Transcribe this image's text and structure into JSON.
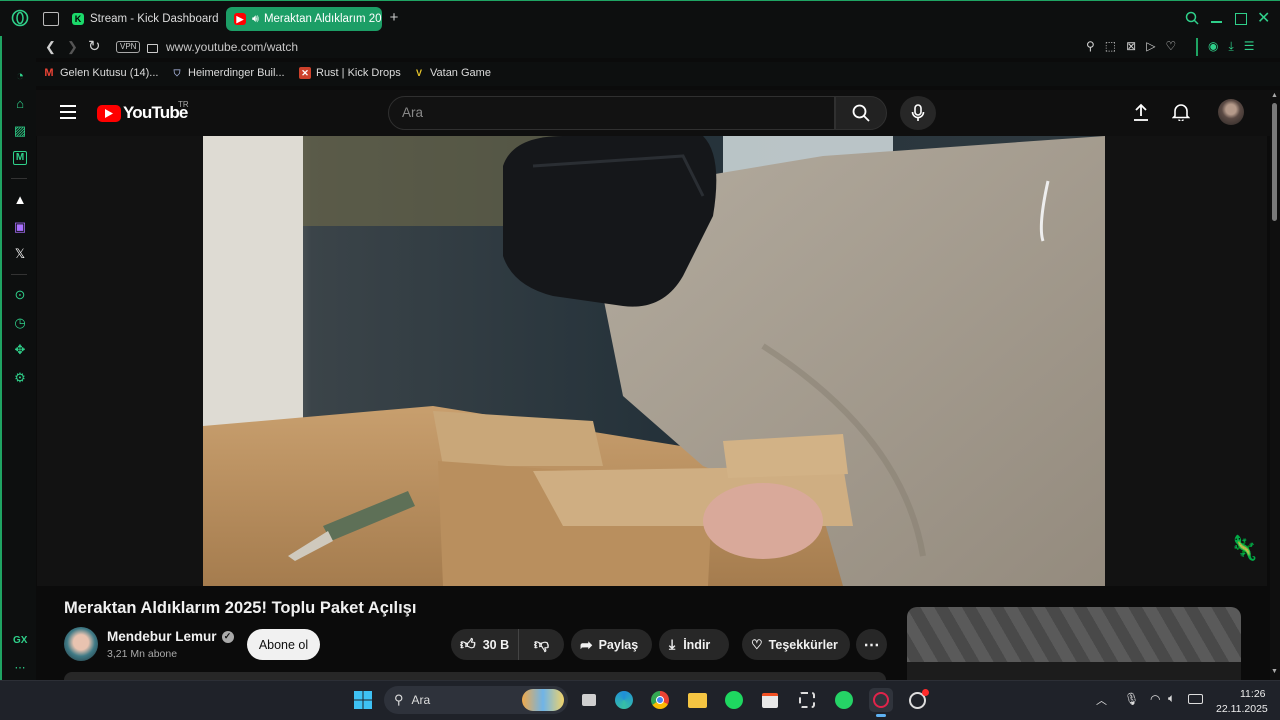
{
  "browser": {
    "tabs": [
      {
        "label": "Stream - Kick Dashboard",
        "active": false
      },
      {
        "label": "Meraktan Aldıklarım 20",
        "active": true
      }
    ],
    "vpn_label": "VPN",
    "url": "www.youtube.com/watch",
    "bookmarks": [
      {
        "label": "Gelen Kutusu (14)..."
      },
      {
        "label": "Heimerdinger Buil..."
      },
      {
        "label": "Rust | Kick Drops"
      },
      {
        "label": "Vatan Game"
      }
    ],
    "sidebar_gx": "GX",
    "accent": "#1fa463"
  },
  "youtube": {
    "logo_text": "YouTube",
    "region": "TR",
    "search_placeholder": "Ara",
    "video_title": "Meraktan Aldıklarım 2025! Toplu Paket Açılışı",
    "channel_name": "Mendebur Lemur",
    "subscribers": "3,21 Mn abone",
    "subscribe_label": "Abone ol",
    "likes": "30 B",
    "share_label": "Paylaş",
    "download_label": "İndir",
    "thanks_label": "Teşekkürler"
  },
  "taskbar": {
    "search_label": "Ara",
    "time": "11:26",
    "date": "22.11.2025"
  }
}
